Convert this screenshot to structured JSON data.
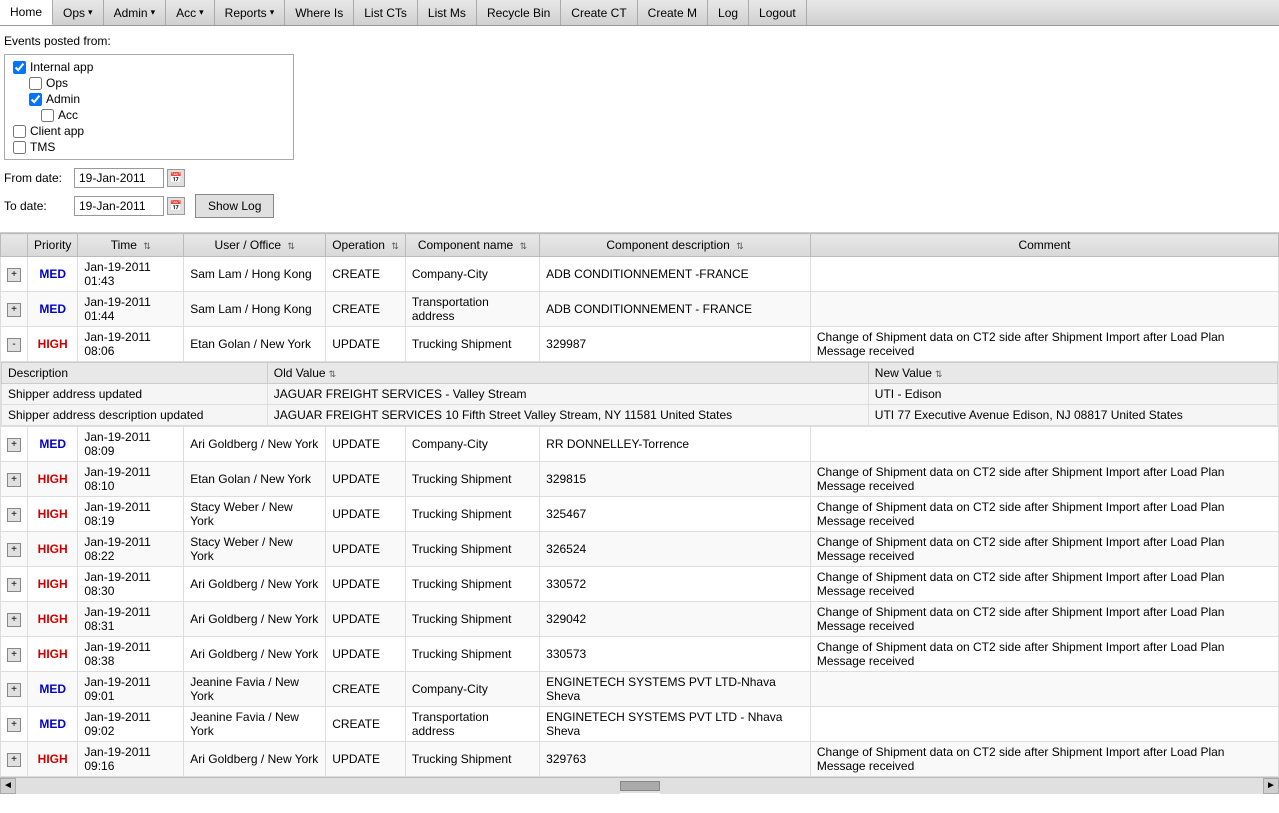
{
  "nav": {
    "items": [
      {
        "label": "Home",
        "active": false
      },
      {
        "label": "Ops",
        "hasArrow": true
      },
      {
        "label": "Admin",
        "hasArrow": true
      },
      {
        "label": "Acc",
        "hasArrow": true
      },
      {
        "label": "Reports",
        "hasArrow": true
      },
      {
        "label": "Where Is",
        "hasArrow": false
      },
      {
        "label": "List CTs",
        "hasArrow": false
      },
      {
        "label": "List Ms",
        "hasArrow": false
      },
      {
        "label": "Recycle Bin",
        "hasArrow": false
      },
      {
        "label": "Create CT",
        "hasArrow": false
      },
      {
        "label": "Create M",
        "hasArrow": false
      },
      {
        "label": "Log",
        "hasArrow": false
      },
      {
        "label": "Logout",
        "hasArrow": false
      }
    ]
  },
  "filter": {
    "events_label": "Events posted from:",
    "checkboxes": [
      {
        "label": "Internal app",
        "checked": true,
        "indent": 0
      },
      {
        "label": "Ops",
        "checked": false,
        "indent": 1
      },
      {
        "label": "Admin",
        "checked": true,
        "indent": 1
      },
      {
        "label": "Acc",
        "checked": false,
        "indent": 2
      },
      {
        "label": "Client app",
        "checked": false,
        "indent": 0
      },
      {
        "label": "TMS",
        "checked": false,
        "indent": 0
      }
    ],
    "from_date_label": "From date:",
    "from_date_value": "19-Jan-2011",
    "to_date_label": "To date:",
    "to_date_value": "19-Jan-2011",
    "show_log_label": "Show Log"
  },
  "table": {
    "headers": [
      {
        "label": "",
        "sortable": false
      },
      {
        "label": "Priority",
        "sortable": false
      },
      {
        "label": "Time",
        "sortable": true
      },
      {
        "label": "User / Office",
        "sortable": true
      },
      {
        "label": "Operation",
        "sortable": true
      },
      {
        "label": "Component name",
        "sortable": true
      },
      {
        "label": "Component description",
        "sortable": true
      },
      {
        "label": "Comment",
        "sortable": false
      }
    ],
    "rows": [
      {
        "expand": "+",
        "priority": "MED",
        "time": "Jan-19-2011 01:43",
        "user": "Sam Lam / Hong Kong",
        "operation": "CREATE",
        "component": "Company-City",
        "description": "ADB CONDITIONNEMENT -FRANCE",
        "comment": "",
        "expanded": false
      },
      {
        "expand": "+",
        "priority": "MED",
        "time": "Jan-19-2011 01:44",
        "user": "Sam Lam / Hong Kong",
        "operation": "CREATE",
        "component": "Transportation address",
        "description": "ADB CONDITIONNEMENT - FRANCE",
        "comment": "",
        "expanded": false
      },
      {
        "expand": "-",
        "priority": "HIGH",
        "time": "Jan-19-2011 08:06",
        "user": "Etan Golan / New York",
        "operation": "UPDATE",
        "component": "Trucking Shipment",
        "description": "329987",
        "comment": "Change of Shipment data on CT2 side after Shipment Import after Load Plan Message received",
        "expanded": true,
        "details": [
          {
            "description": "Shipper address updated",
            "old_value": "JAGUAR FREIGHT SERVICES - Valley Stream",
            "new_value": "UTI - Edison"
          },
          {
            "description": "Shipper address description updated",
            "old_value": "JAGUAR FREIGHT SERVICES 10 Fifth Street Valley Stream, NY 11581 United States",
            "new_value": "UTI 77 Executive Avenue Edison, NJ 08817 United States"
          }
        ]
      },
      {
        "expand": "+",
        "priority": "MED",
        "time": "Jan-19-2011 08:09",
        "user": "Ari Goldberg / New York",
        "operation": "UPDATE",
        "component": "Company-City",
        "description": "RR DONNELLEY-Torrence",
        "comment": "",
        "expanded": false
      },
      {
        "expand": "+",
        "priority": "HIGH",
        "time": "Jan-19-2011 08:10",
        "user": "Etan Golan / New York",
        "operation": "UPDATE",
        "component": "Trucking Shipment",
        "description": "329815",
        "comment": "Change of Shipment data on CT2 side after Shipment Import after Load Plan Message received",
        "expanded": false
      },
      {
        "expand": "+",
        "priority": "HIGH",
        "time": "Jan-19-2011 08:19",
        "user": "Stacy Weber / New York",
        "operation": "UPDATE",
        "component": "Trucking Shipment",
        "description": "325467",
        "comment": "Change of Shipment data on CT2 side after Shipment Import after Load Plan Message received",
        "expanded": false
      },
      {
        "expand": "+",
        "priority": "HIGH",
        "time": "Jan-19-2011 08:22",
        "user": "Stacy Weber / New York",
        "operation": "UPDATE",
        "component": "Trucking Shipment",
        "description": "326524",
        "comment": "Change of Shipment data on CT2 side after Shipment Import after Load Plan Message received",
        "expanded": false
      },
      {
        "expand": "+",
        "priority": "HIGH",
        "time": "Jan-19-2011 08:30",
        "user": "Ari Goldberg / New York",
        "operation": "UPDATE",
        "component": "Trucking Shipment",
        "description": "330572",
        "comment": "Change of Shipment data on CT2 side after Shipment Import after Load Plan Message received",
        "expanded": false
      },
      {
        "expand": "+",
        "priority": "HIGH",
        "time": "Jan-19-2011 08:31",
        "user": "Ari Goldberg / New York",
        "operation": "UPDATE",
        "component": "Trucking Shipment",
        "description": "329042",
        "comment": "Change of Shipment data on CT2 side after Shipment Import after Load Plan Message received",
        "expanded": false
      },
      {
        "expand": "+",
        "priority": "HIGH",
        "time": "Jan-19-2011 08:38",
        "user": "Ari Goldberg / New York",
        "operation": "UPDATE",
        "component": "Trucking Shipment",
        "description": "330573",
        "comment": "Change of Shipment data on CT2 side after Shipment Import after Load Plan Message received",
        "expanded": false
      },
      {
        "expand": "+",
        "priority": "MED",
        "time": "Jan-19-2011 09:01",
        "user": "Jeanine Favia / New York",
        "operation": "CREATE",
        "component": "Company-City",
        "description": "ENGINETECH SYSTEMS PVT LTD-Nhava Sheva",
        "comment": "",
        "expanded": false
      },
      {
        "expand": "+",
        "priority": "MED",
        "time": "Jan-19-2011 09:02",
        "user": "Jeanine Favia / New York",
        "operation": "CREATE",
        "component": "Transportation address",
        "description": "ENGINETECH SYSTEMS PVT LTD - Nhava Sheva",
        "comment": "",
        "expanded": false
      },
      {
        "expand": "+",
        "priority": "HIGH",
        "time": "Jan-19-2011 09:16",
        "user": "Ari Goldberg / New York",
        "operation": "UPDATE",
        "component": "Trucking Shipment",
        "description": "329763",
        "comment": "Change of Shipment data on CT2 side after Shipment Import after Load Plan Message received",
        "expanded": false
      }
    ],
    "detail_headers": {
      "description": "Description",
      "old_value": "Old Value",
      "new_value": "New Value"
    }
  }
}
